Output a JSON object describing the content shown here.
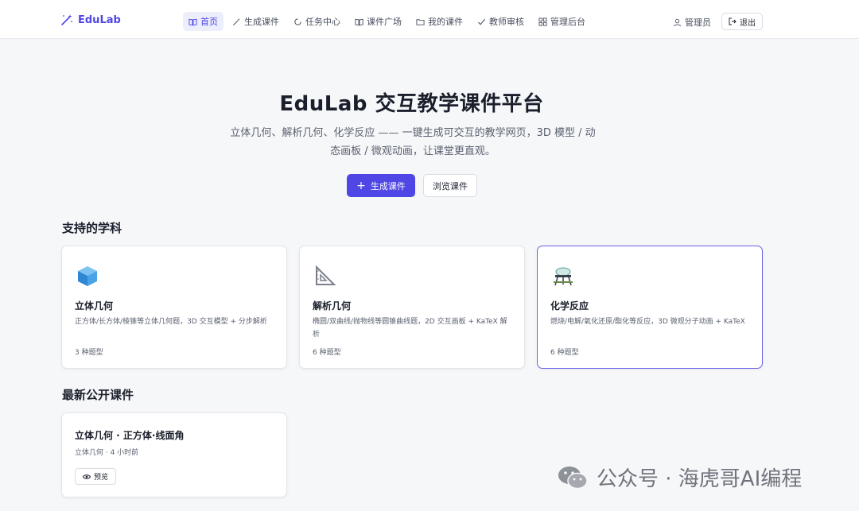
{
  "header": {
    "brand": "EduLab",
    "nav": [
      {
        "label": "首页",
        "icon": "book-open-icon",
        "active": true
      },
      {
        "label": "生成课件",
        "icon": "magic-wand-icon",
        "active": false
      },
      {
        "label": "任务中心",
        "icon": "spinner-icon",
        "active": false
      },
      {
        "label": "课件广场",
        "icon": "book-icon",
        "active": false
      },
      {
        "label": "我的课件",
        "icon": "folder-icon",
        "active": false
      },
      {
        "label": "教师审核",
        "icon": "check-icon",
        "active": false
      },
      {
        "label": "管理后台",
        "icon": "grid-icon",
        "active": false
      }
    ],
    "user": "管理员",
    "logout": "退出"
  },
  "hero": {
    "title": "EduLab 交互教学课件平台",
    "subtitle": "立体几何、解析几何、化学反应 —— 一键生成可交互的教学网页，3D 模型 / 动态画板 / 微观动画，让课堂更直观。",
    "primary_button": "生成课件",
    "secondary_button": "浏览课件"
  },
  "subjects": {
    "section_title": "支持的学科",
    "items": [
      {
        "title": "立体几何",
        "icon": "cube-icon",
        "description": "正方体/长方体/棱锥等立体几何题，3D 交互模型 + 分步解析",
        "count": "3 种题型"
      },
      {
        "title": "解析几何",
        "icon": "triangle-ruler-icon",
        "description": "椭圆/双曲线/抛物线等圆锥曲线题，2D 交互画板 + KaTeX 解析",
        "count": "6 种题型"
      },
      {
        "title": "化学反应",
        "icon": "flask-icon",
        "description": "燃烧/电解/氧化还原/酯化等反应，3D 微观分子动画 + KaTeX",
        "count": "6 种题型"
      }
    ]
  },
  "latest": {
    "section_title": "最新公开课件",
    "items": [
      {
        "title": "立体几何 · 正方体·线面角",
        "meta": "立体几何 · 4 小时前",
        "action": "预览"
      }
    ]
  },
  "watermark": "公众号 · 海虎哥AI编程",
  "colors": {
    "accent": "#4f46e5",
    "background": "#f6f7f9",
    "card_border_selected": "#6b63e8"
  }
}
